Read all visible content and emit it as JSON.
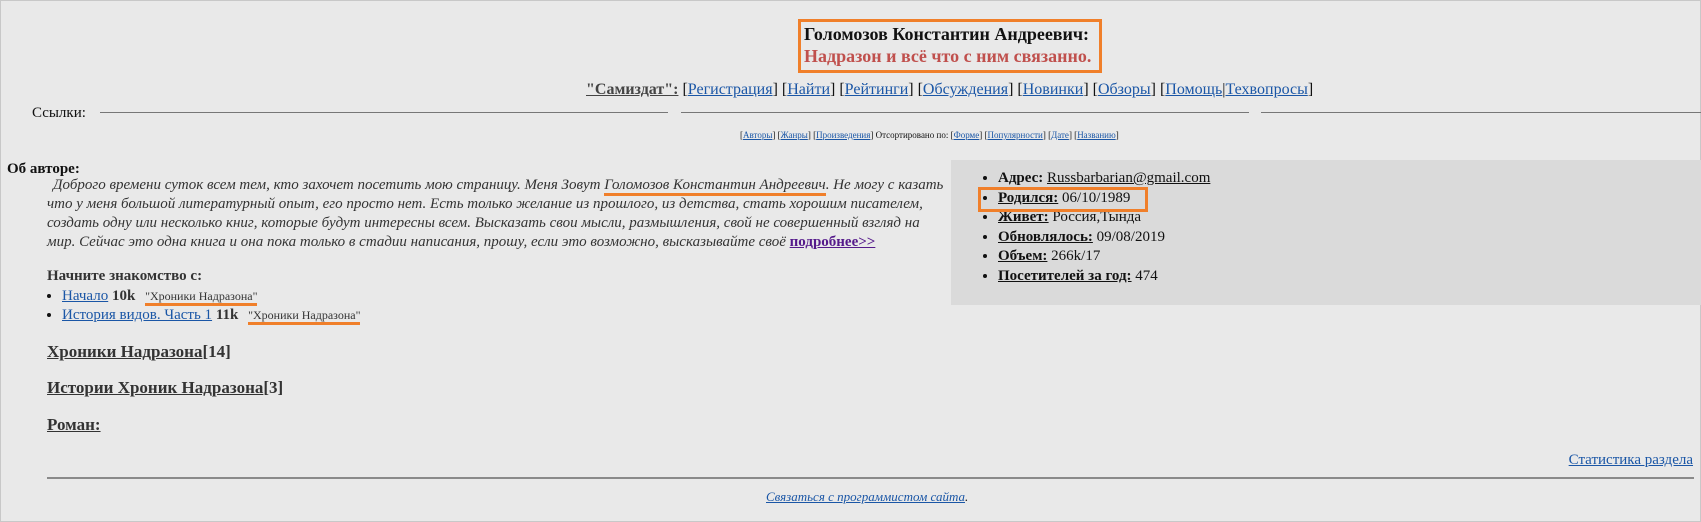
{
  "header": {
    "author_name": "Голомозов Константин Андреевич:",
    "subtitle": "Надразон и всё что с ним связанно."
  },
  "nav": {
    "samizdat": "\"Самиздат\":",
    "items": [
      "Регистрация",
      "Найти",
      "Рейтинги",
      "Обсуждения",
      "Новинки",
      "Обзоры",
      "Помощь",
      "Техвопросы"
    ]
  },
  "links_label": "Ссылки:",
  "sortbar": {
    "items": [
      "Авторы",
      "Жанры",
      "Произведения"
    ],
    "sorted_label": "Отсортировано по:",
    "sort_options": [
      "Форме",
      "Популярности",
      "Дате",
      "Названию"
    ]
  },
  "about": {
    "label": "Об авторе:",
    "text_part1": "Доброго времени суток всем тем, кто захочет посетить мою страницу. Меня Зовут ",
    "name": "Голомозов Константин Андреевич",
    "text_part2": ". Не могу с казать что у меня большой литературный опыт, его просто нет. Есть только желание из прошлого, из детства, стать хорошим писателем, создать одну или несколько книг, которые будут интересны всем. Высказать свои мысли, размышления, свой не совершенный взгляд на мир. Сейчас это одна книга и она пока только в стадии написания, прошу, если это возможно, высказывайте своё ",
    "more_link": "подробнее>>"
  },
  "start": {
    "label": "Начните знакомство с:",
    "items": [
      {
        "title": "Начало",
        "size": "10k",
        "cycle": "\"Хроники Надразона\""
      },
      {
        "title": "История видов. Часть 1",
        "size": "11k",
        "cycle": "\"Хроники Надразона\""
      }
    ]
  },
  "sections": [
    {
      "title": "Хроники Надразона",
      "count": "[14]"
    },
    {
      "title": "Истории Хроник Надразона",
      "count": "[3]"
    },
    {
      "title": "Роман:",
      "count": ""
    }
  ],
  "info": {
    "address_label": "Адрес:",
    "address_value": "Russbarbarian@gmail.com",
    "born_label": "Родился:",
    "born_value": "06/10/1989",
    "lives_label": "Живет:",
    "lives_value": "Россия,Тында",
    "updated_label": "Обновлялось:",
    "updated_value": "09/08/2019",
    "volume_label": "Объем:",
    "volume_value": "266k/17",
    "visitors_label": "Посетителей за год:",
    "visitors_value": "474"
  },
  "footer": {
    "stats_link": "Статистика раздела",
    "contact_link": "Связаться с программистом сайта",
    "contact_suffix": "."
  },
  "colors": {
    "background": "#e9e9e9",
    "highlight_orange": "#f07f2a",
    "subtitle_red": "#c0504d",
    "link_blue": "#1a56a6"
  }
}
